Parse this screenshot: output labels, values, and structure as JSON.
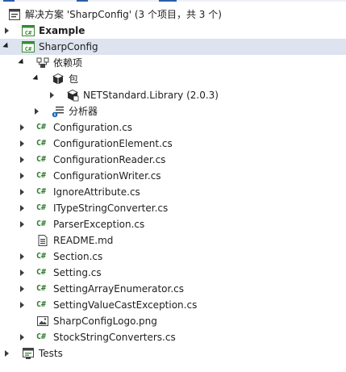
{
  "solution": {
    "title": "解决方案 'SharpConfig' (3 个项目，共 3 个)"
  },
  "projects": {
    "example": {
      "label": "Example",
      "icon": "csharp-project-icon"
    },
    "sharpconfig": {
      "label": "SharpConfig",
      "icon": "csharp-project-icon"
    },
    "tests": {
      "label": "Tests",
      "icon": "test-project-icon"
    }
  },
  "dependencies": {
    "label": "依赖项",
    "packages": {
      "label": "包",
      "items": [
        {
          "label": "NETStandard.Library (2.0.3)"
        }
      ]
    },
    "analyzers": {
      "label": "分析器"
    }
  },
  "files": [
    {
      "label": "Configuration.cs",
      "type": "cs"
    },
    {
      "label": "ConfigurationElement.cs",
      "type": "cs"
    },
    {
      "label": "ConfigurationReader.cs",
      "type": "cs"
    },
    {
      "label": "ConfigurationWriter.cs",
      "type": "cs"
    },
    {
      "label": "IgnoreAttribute.cs",
      "type": "cs"
    },
    {
      "label": "ITypeStringConverter.cs",
      "type": "cs"
    },
    {
      "label": "ParserException.cs",
      "type": "cs"
    },
    {
      "label": "README.md",
      "type": "md"
    },
    {
      "label": "Section.cs",
      "type": "cs"
    },
    {
      "label": "Setting.cs",
      "type": "cs"
    },
    {
      "label": "SettingArrayEnumerator.cs",
      "type": "cs"
    },
    {
      "label": "SettingValueCastException.cs",
      "type": "cs"
    },
    {
      "label": "SharpConfigLogo.png",
      "type": "png"
    },
    {
      "label": "StockStringConverters.cs",
      "type": "cs"
    }
  ],
  "icon_glyphs": {
    "cs": "C#"
  },
  "colors": {
    "selected_row": "#dde3ef",
    "csharp_green": "#2d7a2d",
    "project_icon_green": "#388a34",
    "text": "#1e1e1e"
  }
}
